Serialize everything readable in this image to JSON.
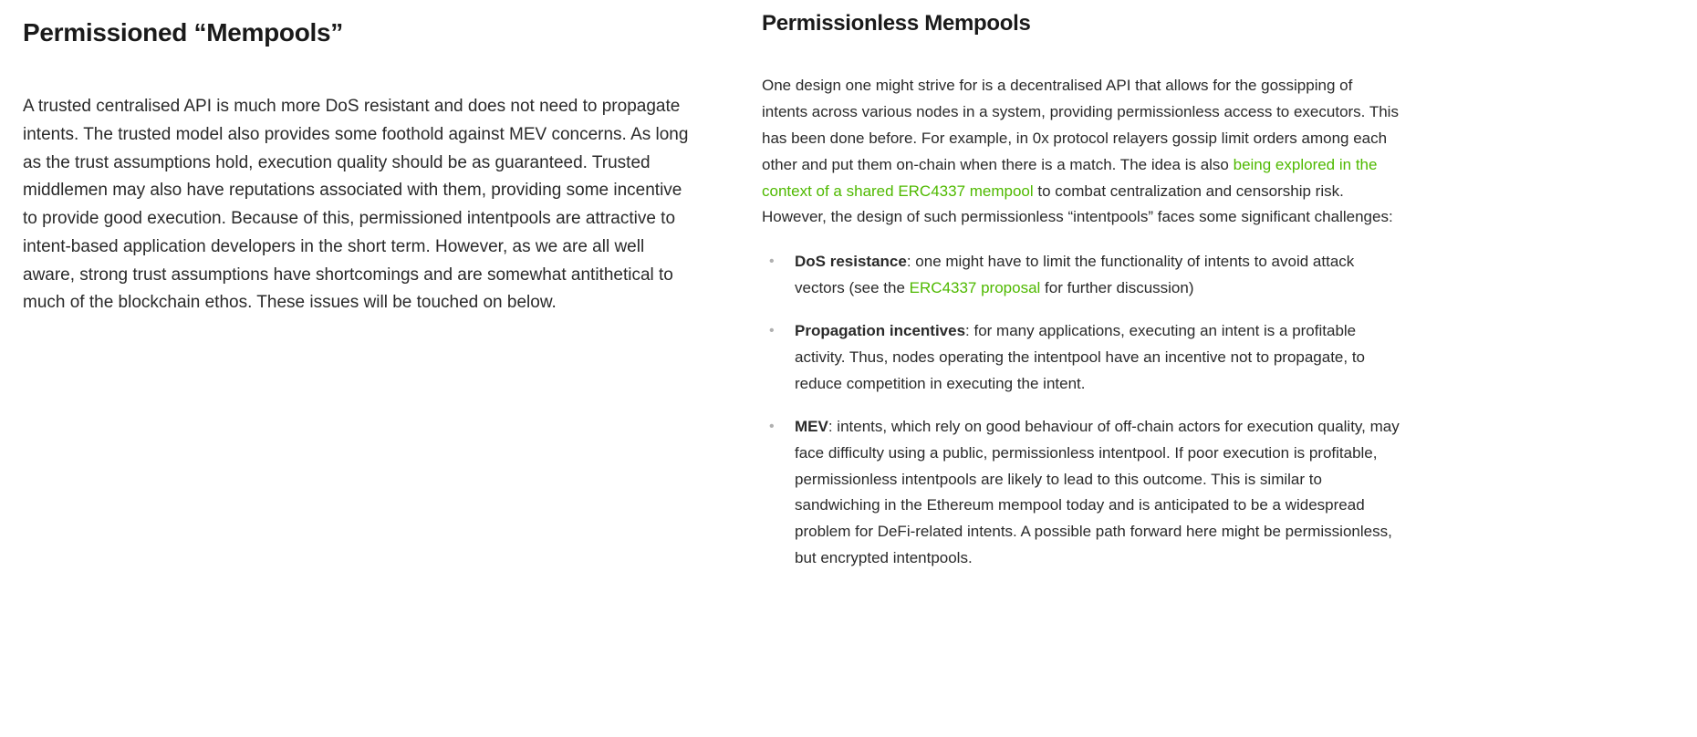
{
  "left": {
    "heading": "Permissioned “Mempools”",
    "paragraph": "A trusted centralised API is much more DoS resistant and does not need to propagate intents. The trusted model also provides some foothold against MEV concerns. As long as the trust assumptions hold, execution quality should be as guaranteed. Trusted middlemen may also have reputations associated with them, providing some incentive to provide good execution. Because of this, permissioned intentpools are attractive to intent-based application developers in the short term. However, as we are all well aware, strong trust assumptions have shortcomings and are somewhat antithetical to much of the blockchain ethos. These issues will be touched on below."
  },
  "right": {
    "heading": "Permissionless Mempools",
    "para_1a": "One design one might strive for is a decentralised API that allows for the gossipping of intents across various nodes in a system, providing permissionless access to executors. This has been done before. For example, in 0x protocol relayers gossip limit orders among each other and put them on-chain when there is a match. The idea is also ",
    "link_1": "being explored in the context of a shared ERC4337 mempool",
    "para_1b": " to combat centralization and censorship risk. However, the design of such permissionless “intentpools” faces some significant challenges:",
    "items": [
      {
        "bold": "DoS resistance",
        "text_a": ": one might have to limit the functionality of intents to avoid attack vectors (see the ",
        "link": "ERC4337 proposal",
        "text_b": " for further discussion)"
      },
      {
        "bold": "Propagation incentives",
        "text_a": ": for many applications, executing an intent is a profitable activity. Thus, nodes operating the intentpool have an incentive not to propagate, to reduce competition in executing the intent.",
        "link": "",
        "text_b": ""
      },
      {
        "bold": "MEV",
        "text_a": ": intents, which rely on good behaviour of off-chain actors for execution quality, may face difficulty using a public, permissionless intentpool. If poor execution is profitable, permissionless intentpools are likely to lead to this outcome. This is similar to sandwiching in the Ethereum mempool today and is anticipated to be a widespread problem for DeFi-related intents. A possible path forward here might be permissionless, but encrypted intentpools.",
        "link": "",
        "text_b": ""
      }
    ]
  }
}
